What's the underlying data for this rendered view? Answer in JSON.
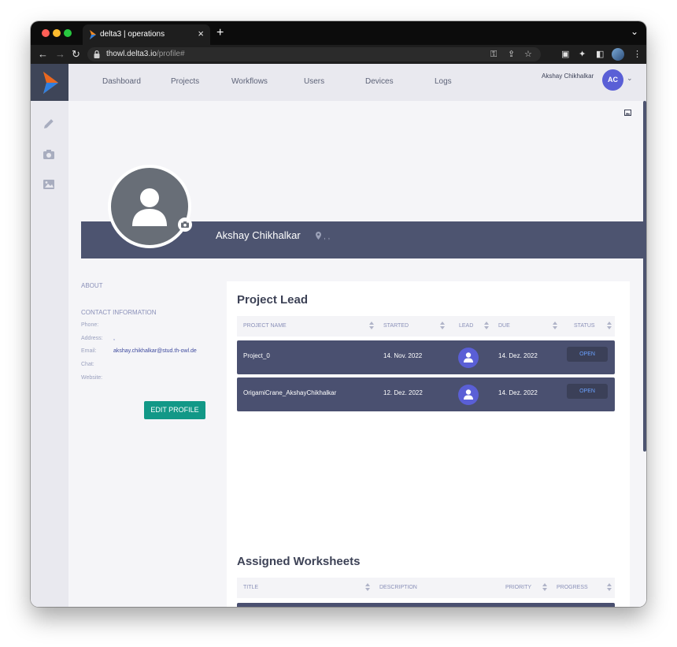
{
  "browser": {
    "tab_title": "delta3 | operations",
    "url_host": "thowl.delta3.io",
    "url_path": "/profile#"
  },
  "nav": {
    "items": [
      "Dashboard",
      "Projects",
      "Workflows",
      "Users",
      "Devices",
      "Logs"
    ],
    "user_name": "Akshay Chikhalkar",
    "user_initials": "AC"
  },
  "profile": {
    "name": "Akshay Chikhalkar",
    "location": ", ,"
  },
  "about": {
    "heading": "ABOUT",
    "contact_heading": "CONTACT INFORMATION",
    "phone_label": "Phone:",
    "phone_value": "",
    "address_label": "Address:",
    "address_value": ",",
    "email_label": "Email:",
    "email_value": "akshay.chikhalkar@stud.th-owl.de",
    "chat_label": "Chat:",
    "chat_value": "",
    "website_label": "Website:",
    "website_value": "",
    "edit_button": "EDIT PROFILE"
  },
  "project_lead": {
    "title": "Project Lead",
    "columns": [
      "PROJECT NAME",
      "STARTED",
      "LEAD",
      "DUE",
      "STATUS"
    ],
    "rows": [
      {
        "name": "Project_0",
        "started": "14. Nov. 2022",
        "due": "14. Dez. 2022",
        "status": "OPEN"
      },
      {
        "name": "OrigamiCrane_AkshayChikhalkar",
        "started": "12. Dez. 2022",
        "due": "14. Dez. 2022",
        "status": "OPEN"
      }
    ]
  },
  "assigned_worksheets": {
    "title": "Assigned Worksheets",
    "columns": [
      "TITLE",
      "DESCRIPTION",
      "PRIORITY",
      "PROGRESS"
    ]
  },
  "colors": {
    "banner": "#4d5470",
    "accent": "#5a5fd6",
    "edit_button": "#129887",
    "status_text": "#6aa0ff"
  }
}
